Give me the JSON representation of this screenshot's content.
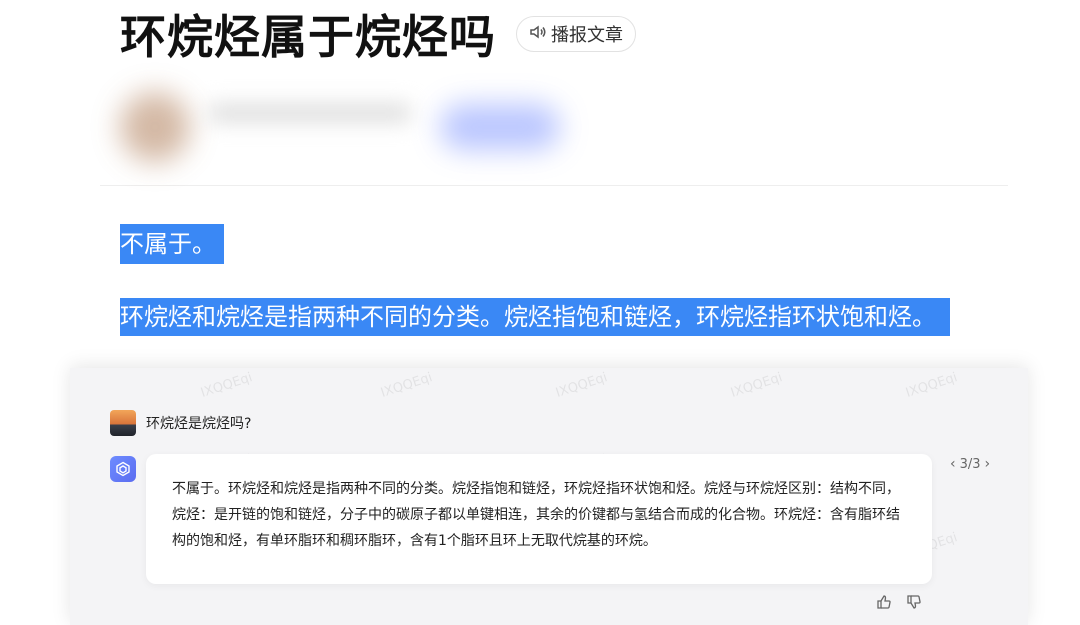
{
  "article": {
    "title": "环烷烃属于烷烃吗",
    "listen_label": "播报文章",
    "selected_line_1": "不属于。",
    "selected_line_2": "环烷烃和烷烃是指两种不同的分类。烷烃指饱和链烃，环烷烃指环状饱和烃。"
  },
  "chat": {
    "user_question": "环烷烃是烷烃吗?",
    "answer": "不属于。环烷烃和烷烃是指两种不同的分类。烷烃指饱和链烃，环烷烃指环状饱和烃。烷烃与环烷烃区别：结构不同，烷烃：是开链的饱和链烃，分子中的碳原子都以单键相连，其余的价键都与氢结合而成的化合物。环烷烃：含有脂环结构的饱和烃，有单环脂环和稠环脂环，含有1个脂环且环上无取代烷基的环烷。",
    "pager": "3/3",
    "watermark_text": "IXQQEqi"
  },
  "icons": {
    "listen": "speaker-icon",
    "user_avatar": "sunset-avatar",
    "bot_avatar": "cube-icon",
    "prev": "chevron-left-icon",
    "next": "chevron-right-icon",
    "thumbs_up": "thumbs-up-icon",
    "thumbs_down": "thumbs-down-icon"
  },
  "colors": {
    "selection": "#3a88f5",
    "panel_bg": "#f4f4f6",
    "bot_avatar": "#5b6cf0"
  }
}
